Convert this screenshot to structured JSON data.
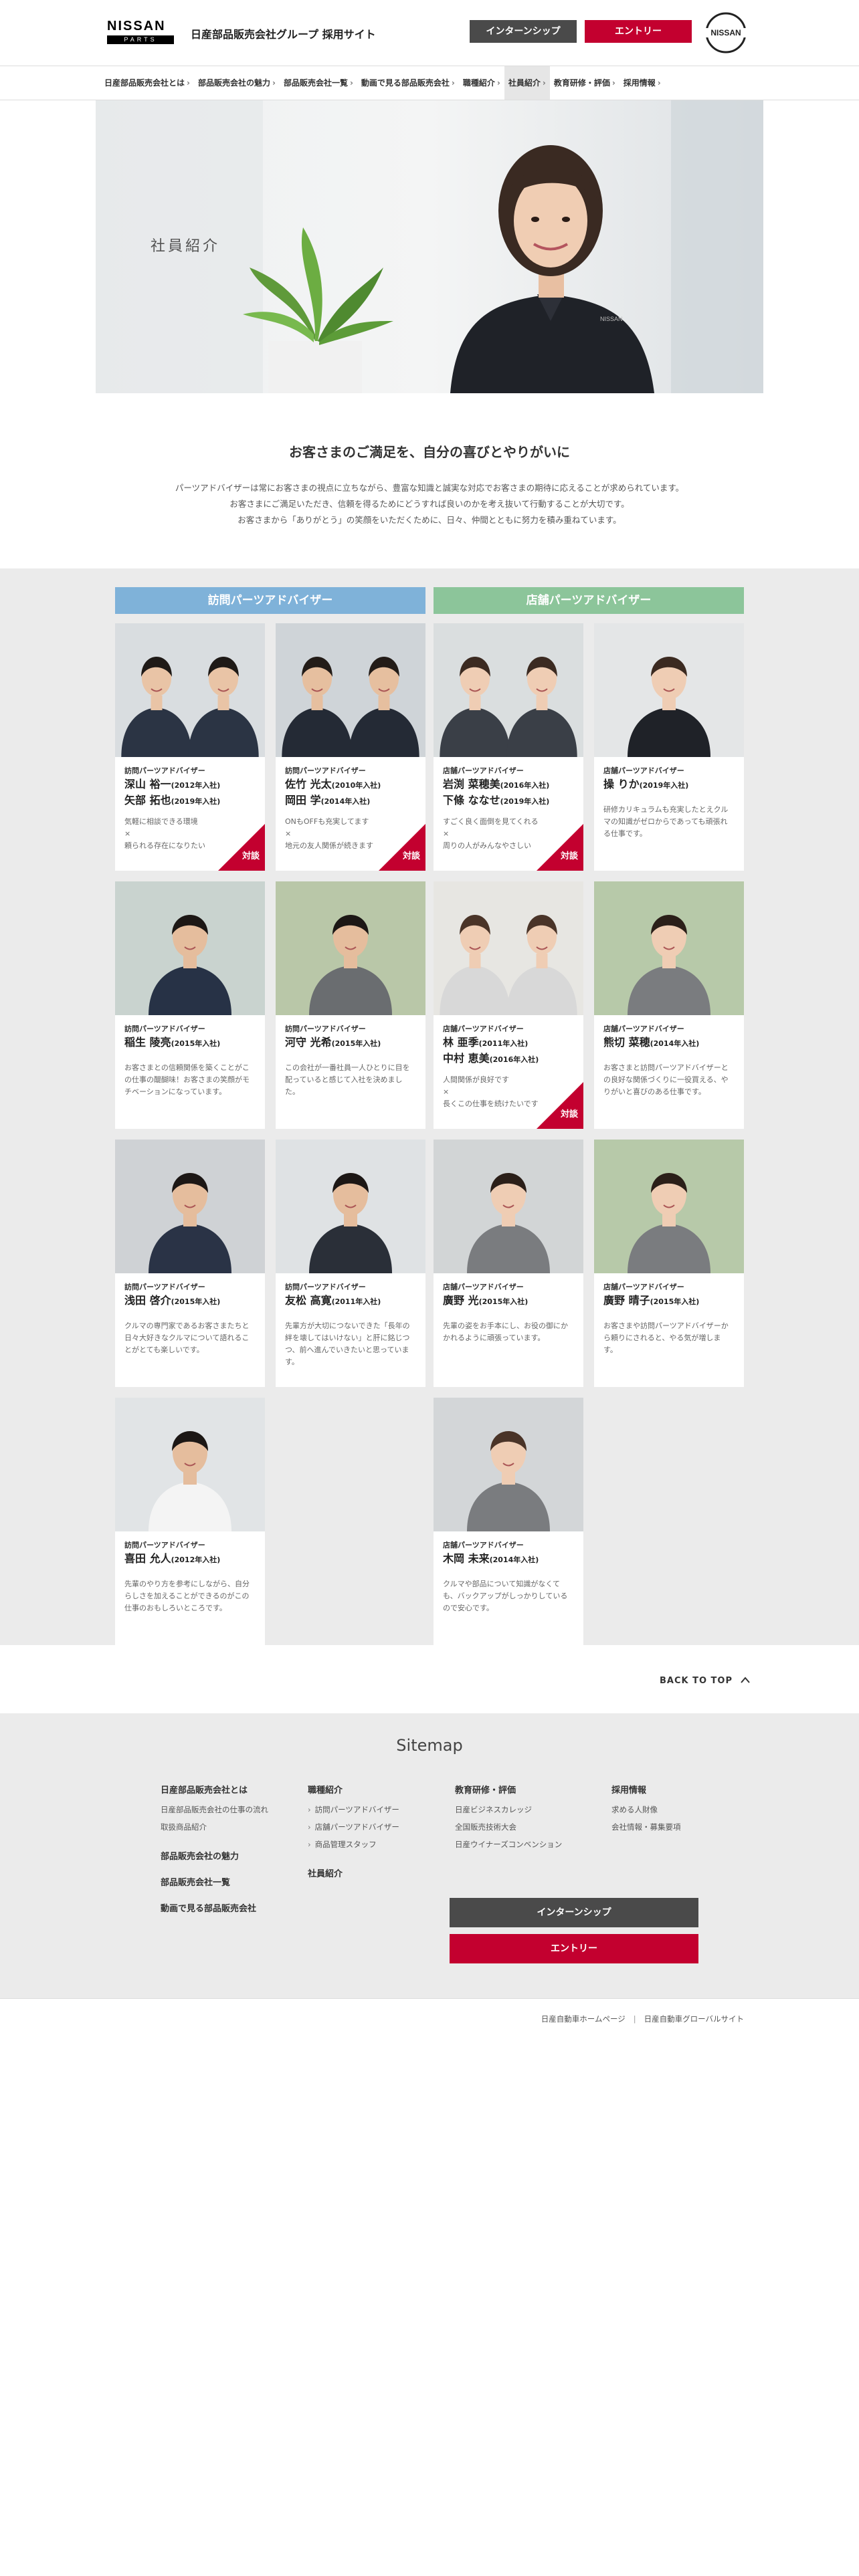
{
  "header": {
    "logo_word": "NISSAN",
    "logo_sub": "PARTS",
    "site_title": "日産部品販売会社グループ 採用サイト",
    "intern_label": "インターンシップ",
    "entry_label": "エントリー",
    "badge_word": "NISSAN"
  },
  "nav": {
    "items": [
      {
        "label": "日産部品販売会社とは"
      },
      {
        "label": "部品販売会社の魅力"
      },
      {
        "label": "部品販売会社一覧"
      },
      {
        "label": "動画で見る部品販売会社"
      },
      {
        "label": "職種紹介"
      },
      {
        "label": "社員紹介"
      },
      {
        "label": "教育研修・評価"
      },
      {
        "label": "採用情報"
      }
    ],
    "active_index": 5
  },
  "hero": {
    "title": "社員紹介",
    "shirt_text": "NISSAN"
  },
  "intro": {
    "heading": "お客さまのご満足を、自分の喜びとやりがいに",
    "lines": [
      "パーツアドバイザーは常にお客さまの視点に立ちながら、豊富な知識と誠実な対応でお客さまの期待に応えることが求められています。",
      "お客さまにご満足いただき、信頼を得るためにどうすれば良いのかを考え抜いて行動することが大切です。",
      "お客さまから「ありがとう」の笑顔をいただくために、日々、仲間とともに努力を積み重ねています。"
    ]
  },
  "categories": {
    "visit": "訪問パーツアドバイザー",
    "store": "店舗パーツアドバイザー"
  },
  "badge_label": "対談",
  "cards": [
    {
      "role": "訪問パーツアドバイザー",
      "names": [
        {
          "n": "深山 裕一",
          "y": "(2012年入社)"
        },
        {
          "n": "矢部 拓也",
          "y": "(2019年入社)"
        }
      ],
      "desc": [
        "気軽に相談できる環境",
        "×",
        "頼られる存在になりたい"
      ],
      "taidan": true,
      "people": 2
    },
    {
      "role": "訪問パーツアドバイザー",
      "names": [
        {
          "n": "佐竹 光太",
          "y": "(2010年入社)"
        },
        {
          "n": "岡田 学",
          "y": "(2014年入社)"
        }
      ],
      "desc": [
        "ONもOFFも充実してます",
        "×",
        "地元の友人関係が続きます"
      ],
      "taidan": true,
      "people": 2
    },
    {
      "role": "店舗パーツアドバイザー",
      "names": [
        {
          "n": "岩渕 菜穂美",
          "y": "(2016年入社)"
        },
        {
          "n": "下條 ななせ",
          "y": "(2019年入社)"
        }
      ],
      "desc": [
        "すごく良く面倒を見てくれる",
        "×",
        "周りの人がみんなやさしい"
      ],
      "taidan": true,
      "people": 2
    },
    {
      "role": "店舗パーツアドバイザー",
      "names": [
        {
          "n": "操 りか",
          "y": "(2019年入社)"
        }
      ],
      "desc": [
        "研修カリキュラムも充実したとえクルマの知識がゼロからであっても頑張れる仕事です。"
      ],
      "taidan": false,
      "people": 1
    },
    {
      "role": "訪問パーツアドバイザー",
      "names": [
        {
          "n": "稲生 陵亮",
          "y": "(2015年入社)"
        }
      ],
      "desc": [
        "お客さまとの信頼関係を築くことがこの仕事の醍醐味！お客さまの笑顔がモチベーションになっています。"
      ],
      "taidan": false,
      "people": 1
    },
    {
      "role": "訪問パーツアドバイザー",
      "names": [
        {
          "n": "河守 光希",
          "y": "(2015年入社)"
        }
      ],
      "desc": [
        "この会社が一番社員一人ひとりに目を配っていると感じて入社を決めました。"
      ],
      "taidan": false,
      "people": 1
    },
    {
      "role": "店舗パーツアドバイザー",
      "names": [
        {
          "n": "林 亜季",
          "y": "(2011年入社)"
        },
        {
          "n": "中村 恵美",
          "y": "(2016年入社)"
        }
      ],
      "desc": [
        "人間関係が良好です",
        "×",
        "長くこの仕事を続けたいです"
      ],
      "taidan": true,
      "people": 2
    },
    {
      "role": "店舗パーツアドバイザー",
      "names": [
        {
          "n": "熊切 菜穂",
          "y": "(2014年入社)"
        }
      ],
      "desc": [
        "お客さまと訪問パーツアドバイザーとの良好な関係づくりに一役買える、やりがいと喜びのある仕事です。"
      ],
      "taidan": false,
      "people": 1
    },
    {
      "role": "訪問パーツアドバイザー",
      "names": [
        {
          "n": "浅田 啓介",
          "y": "(2015年入社)"
        }
      ],
      "desc": [
        "クルマの専門家であるお客さまたちと日々大好きなクルマについて語れることがとても楽しいです。"
      ],
      "taidan": false,
      "people": 1
    },
    {
      "role": "訪問パーツアドバイザー",
      "names": [
        {
          "n": "友松 高寛",
          "y": "(2011年入社)"
        }
      ],
      "desc": [
        "先輩方が大切につないできた「長年の絆を壊してはいけない」と肝に銘じつつ、前へ進んでいきたいと思っています。"
      ],
      "taidan": false,
      "people": 1
    },
    {
      "role": "店舗パーツアドバイザー",
      "names": [
        {
          "n": "廣野 光",
          "y": "(2015年入社)"
        }
      ],
      "desc": [
        "先輩の姿をお手本にし、お役の御にかかれるように頑張っています。"
      ],
      "taidan": false,
      "people": 1
    },
    {
      "role": "店舗パーツアドバイザー",
      "names": [
        {
          "n": "廣野 晴子",
          "y": "(2015年入社)"
        }
      ],
      "desc": [
        "お客さまや訪問パーツアドバイザーから頼りにされると、やる気が増します。"
      ],
      "taidan": false,
      "people": 1
    },
    {
      "role": "訪問パーツアドバイザー",
      "names": [
        {
          "n": "喜田 允人",
          "y": "(2012年入社)"
        }
      ],
      "desc": [
        "先輩のやり方を参考にしながら、自分らしさを加えることができるのがこの仕事のおもしろいところです。"
      ],
      "taidan": false,
      "people": 1
    },
    {
      "role": "店舗パーツアドバイザー",
      "names": [
        {
          "n": "木岡 未来",
          "y": "(2014年入社)"
        }
      ],
      "desc": [
        "クルマや部品について知識がなくても、バックアップがしっかりしているので安心です。"
      ],
      "taidan": false,
      "people": 1
    }
  ],
  "backtop": "BACK TO TOP",
  "sitemap": {
    "title": "Sitemap",
    "col1": [
      {
        "head": "日産部品販売会社とは",
        "links": [
          "日産部品販売会社の仕事の流れ",
          "取扱商品紹介"
        ]
      },
      {
        "head": "部品販売会社の魅力",
        "links": []
      },
      {
        "head": "部品販売会社一覧",
        "links": []
      },
      {
        "head": "動画で見る部品販売会社",
        "links": []
      }
    ],
    "col2": [
      {
        "head": "職種紹介",
        "links": [
          "訪問パーツアドバイザー",
          "店舗パーツアドバイザー",
          "商品管理スタッフ"
        ]
      },
      {
        "head": "社員紹介",
        "links": []
      }
    ],
    "col3": [
      {
        "head": "教育研修・評価",
        "links": [
          "日産ビジネスカレッジ",
          "全国販売技術大会",
          "日産ウイナーズコンベンション"
        ]
      }
    ],
    "col4": [
      {
        "head": "採用情報",
        "links": [
          "求める人財像",
          "会社情報・募集要項"
        ]
      }
    ],
    "intern_label": "インターンシップ",
    "entry_label": "エントリー"
  },
  "footer": {
    "link1": "日産自動車ホームページ",
    "link2": "日産自動車グローバルサイト"
  },
  "colors": {
    "accent_red": "#c3002f",
    "dark_gray": "#4a4a4a",
    "visit_blue": "#7fb2d9",
    "store_green": "#8cc59a"
  }
}
